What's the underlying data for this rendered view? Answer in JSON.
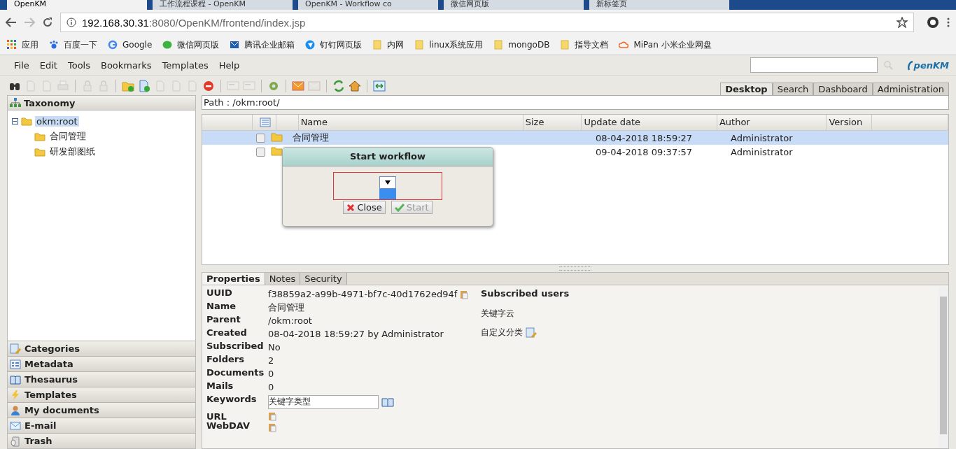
{
  "browser": {
    "tabs": [
      {
        "title": "OpenKM",
        "selected": true
      },
      {
        "title": "工作流程课程 - OpenKM",
        "selected": false
      },
      {
        "title": "OpenKM - Workflow co",
        "selected": false
      },
      {
        "title": "微信网页版",
        "selected": false
      },
      {
        "title": "新标签页",
        "selected": false
      }
    ],
    "address": {
      "host": "192.168.30.31",
      "rest": ":8080/OpenKM/frontend/index.jsp"
    },
    "bookmarks": [
      {
        "label": "应用",
        "kind": "apps"
      },
      {
        "label": "百度一下",
        "kind": "paw"
      },
      {
        "label": "Google",
        "kind": "google"
      },
      {
        "label": "微信网页版",
        "kind": "chat"
      },
      {
        "label": "腾讯企业邮箱",
        "kind": "mail"
      },
      {
        "label": "钉钉网页版",
        "kind": "pin"
      },
      {
        "label": "内网",
        "kind": "folder"
      },
      {
        "label": "linux系统应用",
        "kind": "folder"
      },
      {
        "label": "mongoDB",
        "kind": "folder"
      },
      {
        "label": "指导文档",
        "kind": "folder"
      },
      {
        "label": "MiPan 小米企业网盘",
        "kind": "cloud"
      }
    ]
  },
  "menu": [
    "File",
    "Edit",
    "Tools",
    "Bookmarks",
    "Templates",
    "Help"
  ],
  "logo": "penKM",
  "main_tabs": [
    {
      "label": "Desktop",
      "selected": true
    },
    {
      "label": "Search",
      "selected": false
    },
    {
      "label": "Dashboard",
      "selected": false
    },
    {
      "label": "Administration",
      "selected": false
    }
  ],
  "taxonomy": {
    "title": "Taxonomy",
    "tree": [
      {
        "label": "okm:root",
        "selected": true,
        "expanded": true,
        "children": [
          {
            "label": "合同管理",
            "selected": false
          },
          {
            "label": "研发部图纸",
            "selected": false
          }
        ]
      }
    ]
  },
  "accordion": [
    {
      "label": "Categories",
      "kind": "categories"
    },
    {
      "label": "Metadata",
      "kind": "metadata"
    },
    {
      "label": "Thesaurus",
      "kind": "book"
    },
    {
      "label": "Templates",
      "kind": "bolt"
    },
    {
      "label": "My documents",
      "kind": "user"
    },
    {
      "label": "E-mail",
      "kind": "mail"
    },
    {
      "label": "Trash",
      "kind": "trash"
    }
  ],
  "path": "Path : /okm:root/",
  "table": {
    "columns": [
      "Name",
      "Size",
      "Update date",
      "Author",
      "Version"
    ],
    "rows": [
      {
        "name": "合同管理",
        "update": "08-04-2018 18:59:27",
        "author": "Administrator",
        "selected": true,
        "checked": false
      },
      {
        "update": "09-04-2018 09:37:57",
        "author": "Administrator",
        "selected": false,
        "checked": false
      }
    ]
  },
  "dialog": {
    "title": "Start workflow",
    "buttons": [
      {
        "label": "Close",
        "kind": "close",
        "disabled": false
      },
      {
        "label": "Start",
        "kind": "start",
        "disabled": true
      }
    ]
  },
  "properties": {
    "tabs": [
      {
        "label": "Properties",
        "selected": true
      },
      {
        "label": "Notes",
        "selected": false
      },
      {
        "label": "Security",
        "selected": false
      }
    ],
    "fields": [
      {
        "label": "UUID",
        "value": "f38859a2-a99b-4971-bf7c-40d1762ed94f",
        "kind": "copy"
      },
      {
        "label": "Name",
        "value": "合同管理",
        "kind": "text"
      },
      {
        "label": "Parent",
        "value": "/okm:root",
        "kind": "text"
      },
      {
        "label": "Created",
        "value": "08-04-2018 18:59:27 by Administrator",
        "kind": "text"
      },
      {
        "label": "Subscribed",
        "value": "No",
        "kind": "text"
      },
      {
        "label": "Folders",
        "value": "2",
        "kind": "text"
      },
      {
        "label": "Documents",
        "value": "0",
        "kind": "text"
      },
      {
        "label": "Mails",
        "value": "0",
        "kind": "text"
      },
      {
        "label": "Keywords",
        "value": "关键字类型",
        "kind": "input"
      },
      {
        "label": "URL",
        "kind": "copy"
      },
      {
        "label": "WebDAV",
        "kind": "copy"
      }
    ],
    "subscribed_title": "Subscribed users",
    "side_items": [
      {
        "label": "关键字云",
        "kind": "text"
      },
      {
        "label": "自定义分类",
        "kind": "edit"
      }
    ]
  }
}
